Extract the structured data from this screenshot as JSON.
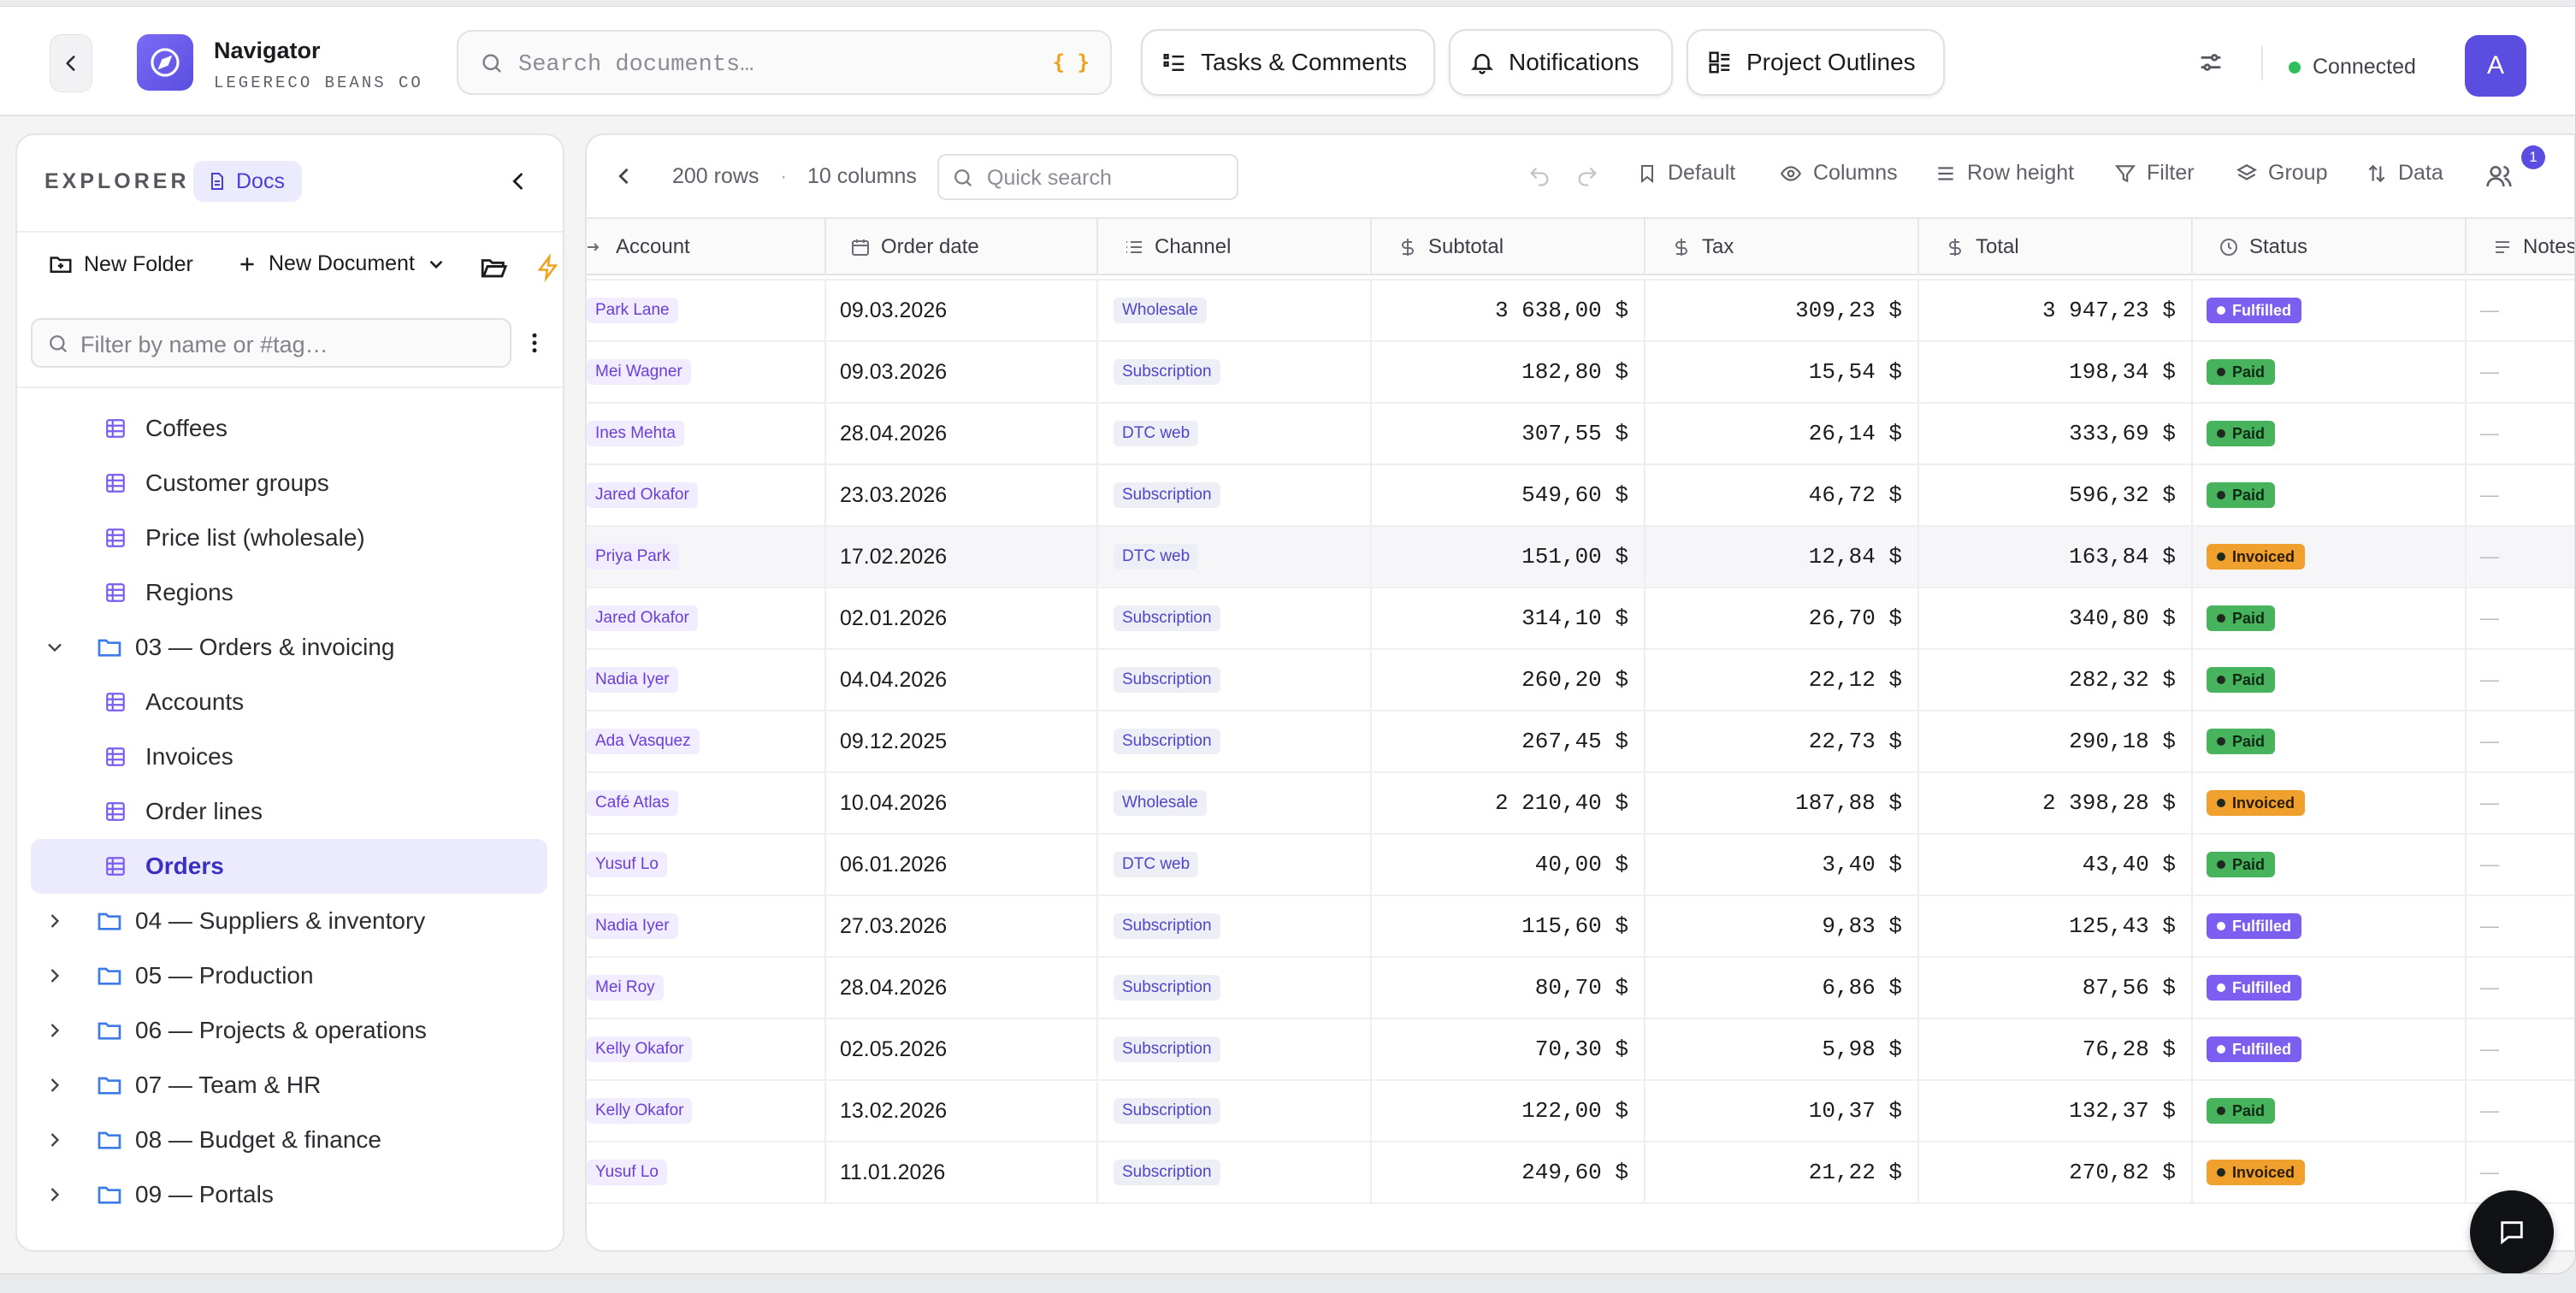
{
  "app": {
    "title": "Navigator",
    "subtitle": "LEGERECO BEANS CO"
  },
  "search": {
    "placeholder": "Search documents…",
    "shortcut": "{ }"
  },
  "nav_pills": {
    "tasks": "Tasks & Comments",
    "notifications": "Notifications",
    "outlines": "Project Outlines"
  },
  "status": {
    "connection": "Connected",
    "avatar_initial": "A"
  },
  "sidebar": {
    "heading": "EXPLORER",
    "docs_badge": "Docs",
    "new_folder": "New Folder",
    "new_document": "New Document",
    "filter_placeholder": "Filter by name or #tag…",
    "items": [
      {
        "label": "Coffees",
        "kind": "doc"
      },
      {
        "label": "Customer groups",
        "kind": "doc"
      },
      {
        "label": "Price list (wholesale)",
        "kind": "doc"
      },
      {
        "label": "Regions",
        "kind": "doc"
      },
      {
        "label": "03 — Orders & invoicing",
        "kind": "folder-open"
      },
      {
        "label": "Accounts",
        "kind": "doc"
      },
      {
        "label": "Invoices",
        "kind": "doc"
      },
      {
        "label": "Order lines",
        "kind": "doc"
      },
      {
        "label": "Orders",
        "kind": "doc",
        "selected": true
      },
      {
        "label": "04 — Suppliers & inventory",
        "kind": "folder"
      },
      {
        "label": "05 — Production",
        "kind": "folder"
      },
      {
        "label": "06 — Projects & operations",
        "kind": "folder"
      },
      {
        "label": "07 — Team & HR",
        "kind": "folder"
      },
      {
        "label": "08 — Budget & finance",
        "kind": "folder"
      },
      {
        "label": "09 — Portals",
        "kind": "folder"
      }
    ]
  },
  "toolbar": {
    "rows": "200 rows",
    "sep": "·",
    "columns_count": "10 columns",
    "quick_search": "Quick search",
    "default": "Default",
    "columns": "Columns",
    "row_height": "Row height",
    "filter": "Filter",
    "group": "Group",
    "data": "Data",
    "collaborators_badge": "1"
  },
  "table": {
    "headers": [
      "Account",
      "Order date",
      "Channel",
      "Subtotal",
      "Tax",
      "Total",
      "Status",
      "Notes"
    ],
    "rows": [
      {
        "account": "Park Lane",
        "date": "09.03.2026",
        "channel": "Wholesale",
        "subtotal": "3 638,00 $",
        "tax": "309,23 $",
        "total": "3 947,23 $",
        "status": "Fulfilled",
        "notes": "—"
      },
      {
        "account": "Mei Wagner",
        "date": "09.03.2026",
        "channel": "Subscription",
        "subtotal": "182,80 $",
        "tax": "15,54 $",
        "total": "198,34 $",
        "status": "Paid",
        "notes": "—"
      },
      {
        "account": "Ines Mehta",
        "date": "28.04.2026",
        "channel": "DTC web",
        "subtotal": "307,55 $",
        "tax": "26,14 $",
        "total": "333,69 $",
        "status": "Paid",
        "notes": "—"
      },
      {
        "account": "Jared Okafor",
        "date": "23.03.2026",
        "channel": "Subscription",
        "subtotal": "549,60 $",
        "tax": "46,72 $",
        "total": "596,32 $",
        "status": "Paid",
        "notes": "—"
      },
      {
        "account": "Priya Park",
        "date": "17.02.2026",
        "channel": "DTC web",
        "subtotal": "151,00 $",
        "tax": "12,84 $",
        "total": "163,84 $",
        "status": "Invoiced",
        "notes": "—"
      },
      {
        "account": "Jared Okafor",
        "date": "02.01.2026",
        "channel": "Subscription",
        "subtotal": "314,10 $",
        "tax": "26,70 $",
        "total": "340,80 $",
        "status": "Paid",
        "notes": "—"
      },
      {
        "account": "Nadia Iyer",
        "date": "04.04.2026",
        "channel": "Subscription",
        "subtotal": "260,20 $",
        "tax": "22,12 $",
        "total": "282,32 $",
        "status": "Paid",
        "notes": "—"
      },
      {
        "account": "Ada Vasquez",
        "date": "09.12.2025",
        "channel": "Subscription",
        "subtotal": "267,45 $",
        "tax": "22,73 $",
        "total": "290,18 $",
        "status": "Paid",
        "notes": "—"
      },
      {
        "account": "Café Atlas",
        "date": "10.04.2026",
        "channel": "Wholesale",
        "subtotal": "2 210,40 $",
        "tax": "187,88 $",
        "total": "2 398,28 $",
        "status": "Invoiced",
        "notes": "—"
      },
      {
        "account": "Yusuf Lo",
        "date": "06.01.2026",
        "channel": "DTC web",
        "subtotal": "40,00 $",
        "tax": "3,40 $",
        "total": "43,40 $",
        "status": "Paid",
        "notes": "—"
      },
      {
        "account": "Nadia Iyer",
        "date": "27.03.2026",
        "channel": "Subscription",
        "subtotal": "115,60 $",
        "tax": "9,83 $",
        "total": "125,43 $",
        "status": "Fulfilled",
        "notes": "—"
      },
      {
        "account": "Mei Roy",
        "date": "28.04.2026",
        "channel": "Subscription",
        "subtotal": "80,70 $",
        "tax": "6,86 $",
        "total": "87,56 $",
        "status": "Fulfilled",
        "notes": "—"
      },
      {
        "account": "Kelly Okafor",
        "date": "02.05.2026",
        "channel": "Subscription",
        "subtotal": "70,30 $",
        "tax": "5,98 $",
        "total": "76,28 $",
        "status": "Fulfilled",
        "notes": "—"
      },
      {
        "account": "Kelly Okafor",
        "date": "13.02.2026",
        "channel": "Subscription",
        "subtotal": "122,00 $",
        "tax": "10,37 $",
        "total": "132,37 $",
        "status": "Paid",
        "notes": "—"
      },
      {
        "account": "Yusuf Lo",
        "date": "11.01.2026",
        "channel": "Subscription",
        "subtotal": "249,60 $",
        "tax": "21,22 $",
        "total": "270,82 $",
        "status": "Invoiced",
        "notes": "—"
      }
    ]
  },
  "colors": {
    "accent": "#5b4de0",
    "paid": "#47b45d",
    "fulfilled": "#7c5ef0",
    "invoiced": "#f0a02c",
    "connected": "#2fbf5a"
  }
}
